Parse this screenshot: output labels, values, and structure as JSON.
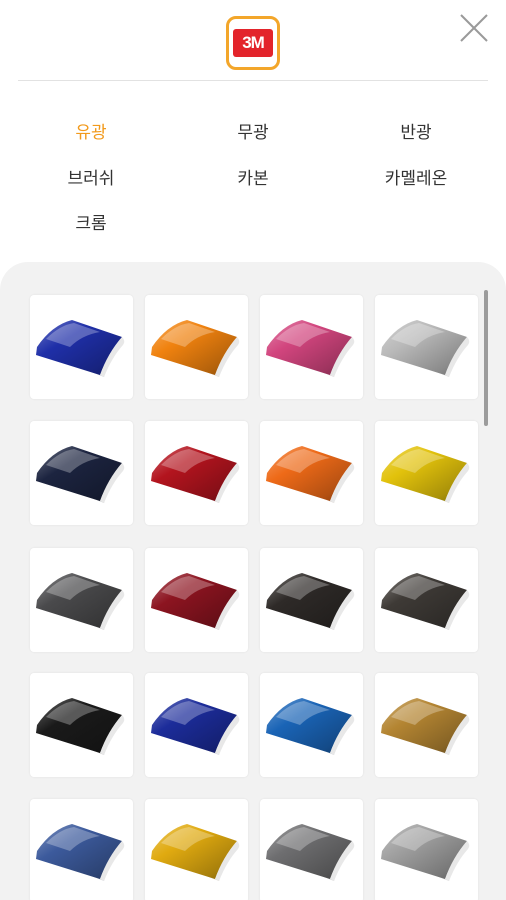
{
  "header": {
    "logo_text": "3M",
    "logo_color": "#e3242b",
    "logo_border_color": "#f3a62a",
    "close_icon": "close-icon"
  },
  "categories": [
    {
      "label": "유광",
      "active": true
    },
    {
      "label": "무광",
      "active": false
    },
    {
      "label": "반광",
      "active": false
    },
    {
      "label": "브러쉬",
      "active": false
    },
    {
      "label": "카본",
      "active": false
    },
    {
      "label": "카멜레온",
      "active": false
    },
    {
      "label": "크롬",
      "active": false
    }
  ],
  "accent_color": "#f29a1c",
  "swatches": [
    {
      "color": "#1f2fa8"
    },
    {
      "color": "#f0820f"
    },
    {
      "color": "#d2457e"
    },
    {
      "color": "#b9b9b9"
    },
    {
      "color": "#1c2440"
    },
    {
      "color": "#b3141e"
    },
    {
      "color": "#ee6a18"
    },
    {
      "color": "#e2c20c"
    },
    {
      "color": "#4a4a4c"
    },
    {
      "color": "#8c1420"
    },
    {
      "color": "#2e2a28"
    },
    {
      "color": "#3e3a36"
    },
    {
      "color": "#1a1a1a"
    },
    {
      "color": "#1c2c9a"
    },
    {
      "color": "#1a64b6"
    },
    {
      "color": "#b48532"
    },
    {
      "color": "#3c5a9c"
    },
    {
      "color": "#e0aa10"
    },
    {
      "color": "#6e6e70"
    },
    {
      "color": "#a0a0a0"
    }
  ]
}
